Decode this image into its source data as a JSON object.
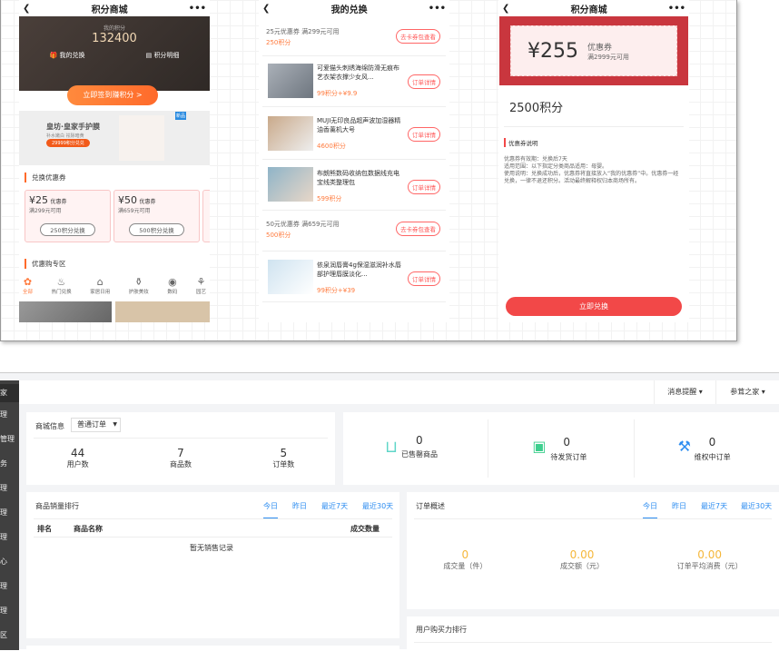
{
  "screen1": {
    "title": "积分商城",
    "my_points_label": "我的积分",
    "points": "132400",
    "my_exchange": "我的兑换",
    "points_detail": "积分明细",
    "sign_btn": "立即签到赚积分 >",
    "banner_title": "皇坊·皇家手护膜",
    "banner_sub": "补水嫩白 祛除暗黄",
    "banner_tag": "29999积分兑兑",
    "banner_badge": "新品",
    "section_coupons": "兑换优惠券",
    "coupons": [
      {
        "amount": "¥25",
        "label": "优惠券",
        "cond": "满299元可用",
        "btn": "250积分兑换"
      },
      {
        "amount": "¥50",
        "label": "优惠券",
        "cond": "满659元可用",
        "btn": "500积分兑换"
      }
    ],
    "section_deals": "优惠购专区",
    "categories": [
      "全部",
      "热门兑换",
      "家居日用",
      "护肤美妆",
      "数码",
      "园艺"
    ]
  },
  "screen2": {
    "title": "我的兑换",
    "items": [
      {
        "type": "coupon",
        "name": "25元优惠券 满299元可用",
        "price": "250积分",
        "btn": "去卡券包查看"
      },
      {
        "type": "product",
        "name": "可爱猫头刺绣海绵防滑无痕布艺衣架衣撑少女风...",
        "price": "99积分+¥9.9",
        "btn": "订单详情"
      },
      {
        "type": "product",
        "name": "MUJI无印良品超声波加湿器精油香薰机大号",
        "price": "4600积分",
        "btn": "订单详情"
      },
      {
        "type": "product",
        "name": "布朗熊数码收纳包数据线充电宝线类整理包",
        "price": "599积分",
        "btn": "订单详情"
      },
      {
        "type": "coupon",
        "name": "50元优惠券 满659元可用",
        "price": "500积分",
        "btn": "去卡券包查看"
      },
      {
        "type": "product",
        "name": "依泉润唇膏4g保湿滋润补水唇部护理唇膜淡化...",
        "price": "99积分+¥39",
        "btn": "订单详情"
      }
    ]
  },
  "screen3": {
    "title": "积分商城",
    "amount": "¥255",
    "coupon_label": "优惠券",
    "cond": "满2999元可用",
    "points": "2500积分",
    "desc_title": "优惠券说明",
    "desc": "优惠券有效期：兑换后7天\n适用范围：以下指定分类商品适用：母婴。\n使用说明：兑换成功后，优惠券将直接放入“我的优惠券”中。优惠券一经兑换，一律不退还积分。活动最终解释权归本商场所有。",
    "btn": "立即兑换"
  },
  "admin": {
    "sidebar": [
      "家",
      "理",
      "管理",
      "务",
      "理",
      "理",
      "理",
      "心",
      "理",
      "理",
      "区"
    ],
    "header": {
      "messages": "消息提醒",
      "user": "参茸之家"
    },
    "shop": {
      "title": "商城信息",
      "select": "普通订单",
      "stats": [
        {
          "value": "44",
          "label": "用户数"
        },
        {
          "value": "7",
          "label": "商品数"
        },
        {
          "value": "5",
          "label": "订单数"
        }
      ]
    },
    "status": [
      {
        "value": "0",
        "label": "已售罄商品"
      },
      {
        "value": "0",
        "label": "待发货订单"
      },
      {
        "value": "0",
        "label": "维权中订单"
      }
    ],
    "tabs": [
      "今日",
      "昨日",
      "最近7天",
      "最近30天"
    ],
    "sales": {
      "title": "商品销量排行",
      "cols": [
        "排名",
        "商品名称",
        "成交数量"
      ],
      "empty": "暂无销售记录"
    },
    "orders": {
      "title": "订单概述",
      "metrics": [
        {
          "value": "0",
          "label": "成交量（件）"
        },
        {
          "value": "0.00",
          "label": "成交额（元）"
        },
        {
          "value": "0.00",
          "label": "订单平均消费（元）"
        }
      ]
    },
    "purchase": {
      "title": "用户购买力排行"
    }
  },
  "colors": {
    "accent": "#ff6a2b",
    "red": "#f24848",
    "blue": "#2c8cf0",
    "gold": "#f5b73b",
    "teal": "#5fd6c8"
  }
}
